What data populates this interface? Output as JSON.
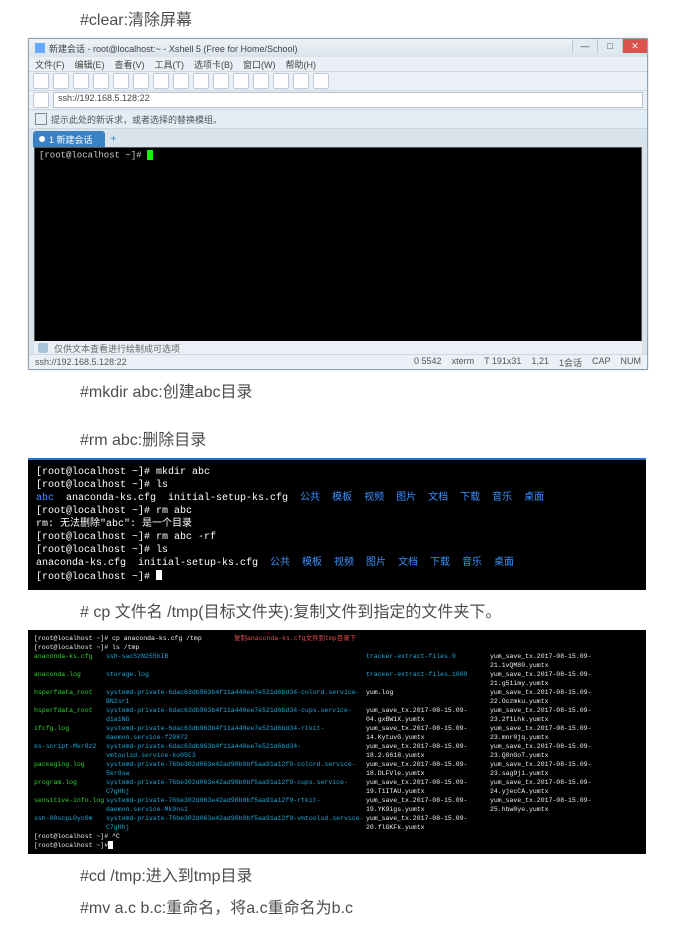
{
  "h1": "#clear:清除屏幕",
  "h2": "#mkdir abc:创建abc目录",
  "h3": "#rm abc:删除目录",
  "h4": "# cp 文件名 /tmp(目标文件夹):复制文件到指定的文件夹下。",
  "h5": "#cd /tmp:进入到tmp目录",
  "h6": "#mv a.c b.c:重命名，将a.c重命名为b.c",
  "shot1": {
    "title": "新建会话 - root@localhost:~ - Xshell 5 (Free for Home/School)",
    "menus": [
      "文件(F)",
      "编辑(E)",
      "查看(V)",
      "工具(T)",
      "选项卡(B)",
      "窗口(W)",
      "帮助(H)"
    ],
    "addr": "ssh://192.168.5.128:22",
    "note": "提示此处的新诉求，或者选择的替换模组。",
    "tab": "1 新建会话",
    "prompt": "[root@localhost ~]# ",
    "statusHint": "仅供文本查看进行绘制成可选项",
    "status": {
      "addr": "ssh://192.168.5.128:22",
      "items": [
        "0 5542",
        "xterm",
        "T 191x31",
        "1,21",
        "1会话",
        "CAP",
        "NUM"
      ]
    }
  },
  "shot2": {
    "lines": [
      {
        "plain": [
          [
            "wh",
            "[root@localhost ~]# mkdir abc"
          ]
        ]
      },
      {
        "plain": [
          [
            "wh",
            "[root@localhost ~]# ls"
          ]
        ]
      },
      {
        "ls": [
          [
            "bl",
            "abc"
          ],
          [
            "wh",
            "  anaconda-ks.cfg  initial-setup-ks.cfg  "
          ],
          [
            "bl",
            "公共  模板  视频  图片  文档  下载  音乐  桌面"
          ]
        ]
      },
      {
        "plain": [
          [
            "wh",
            "[root@localhost ~]# rm abc"
          ]
        ]
      },
      {
        "plain": [
          [
            "wh",
            "rm: 无法删除\"abc\": 是一个目录"
          ]
        ]
      },
      {
        "plain": [
          [
            "wh",
            "[root@localhost ~]# rm abc -rf"
          ]
        ]
      },
      {
        "plain": [
          [
            "wh",
            "[root@localhost ~]# ls"
          ]
        ]
      },
      {
        "ls": [
          [
            "wh",
            "anaconda-ks.cfg  initial-setup-ks.cfg  "
          ],
          [
            "bl",
            "公共  模板  视频  图片  文档  下载  音乐  桌面"
          ]
        ]
      },
      {
        "prompt": true,
        "text": "[root@localhost ~]# "
      }
    ]
  },
  "shot3": {
    "top1": "[root@localhost ~]# cp anaconda-ks.cfg /tmp",
    "topNote": "复制anaconda-ks.cfg文件到tmp目录下",
    "top2": "[root@localhost ~]# ls /tmp",
    "rows": [
      [
        "anaconda-ks.cfg",
        "ssh-sacSzN255hIB",
        "tracker-extract-files.0",
        "yum_save_tx.2017-08-15.09-21.1vQM80.yumtx"
      ],
      [
        "anaconda.log",
        "storage.log",
        "tracker-extract-files.1000",
        "yum_save_tx.2017-08-15.09-21.g51imy.yumtx"
      ],
      [
        "hsperfdata_root",
        "systemd-private-6dac63db963b4f11a440ee7e521d6bd34-colord.service-BN2sr1",
        "yum.log",
        "yum_save_tx.2017-08-15.09-22.Oczmku.yumtx"
      ],
      [
        "hsperfdata_root",
        "systemd-private-6dac63db963b4f11a440ee7e521d6bd34-cups.service-d1a1NG",
        "yum_save_tx.2017-08-15.09-04.gxBW1X.yumtx",
        "yum_save_tx.2017-08-15.09-23.2f1Lhk.yumtx"
      ],
      [
        "ifcfg.log",
        "systemd-private-6dac63db963b4f11a440ee7e521d6bd34-rtkit-daemon.service-f29872",
        "yum_save_tx.2017-08-15.09-14.KytuvG.yumtx",
        "yum_save_tx.2017-08-15.09-23.mnr0jq.yumtx"
      ],
      [
        "ks-script-Mkr8z2",
        "systemd-private-6dac63db963b4f11a440ee7e521d6bd34-vmtoolsd.service-ko05C3",
        "yum_save_tx.2017-08-15.09-18.2.G618.yumtx",
        "yum_save_tx.2017-08-15.09-23.Q0nGoT.yumtx"
      ],
      [
        "packaging.log",
        "systemd-private-76be302d063e42ad98b0bf5aa91a12f9-colord.service-5kr8sw",
        "yum_save_tx.2017-08-15.09-18.DLFVle.yumtx",
        "yum_save_tx.2017-08-15.09-23.sag9ji.yumtx"
      ],
      [
        "program.log",
        "systemd-private-76be302d063e42ad98b0bf5aa91a12f9-cups.service-C7gHhj",
        "yum_save_tx.2017-08-15.09-19.T1ITAU.yumtx",
        "yum_save_tx.2017-08-15.09-24.yjecCA.yumtx"
      ],
      [
        "sensitive-info.log",
        "systemd-private-76be302d063e42ad98b0bf5aa91a12f9-rtkit-daemon.service-Mk9ns1",
        "yum_save_tx.2017-08-15.09-19.YK9igs.yumtx",
        "yum_save_tx.2017-08-15.09-25.hbw0ye.yumtx"
      ],
      [
        "ssh-08scpL0yc0m",
        "systemd-private-76be302d063e42ad98b0bf5aa91a12f9-vmtoolsd.service-C7gHhj",
        "yum_save_tx.2017-08-15.09-20.flGKFk.yumtx",
        ""
      ]
    ],
    "bot1": "[root@localhost ~]# ^C",
    "bot2": "[root@localhost ~]# "
  }
}
